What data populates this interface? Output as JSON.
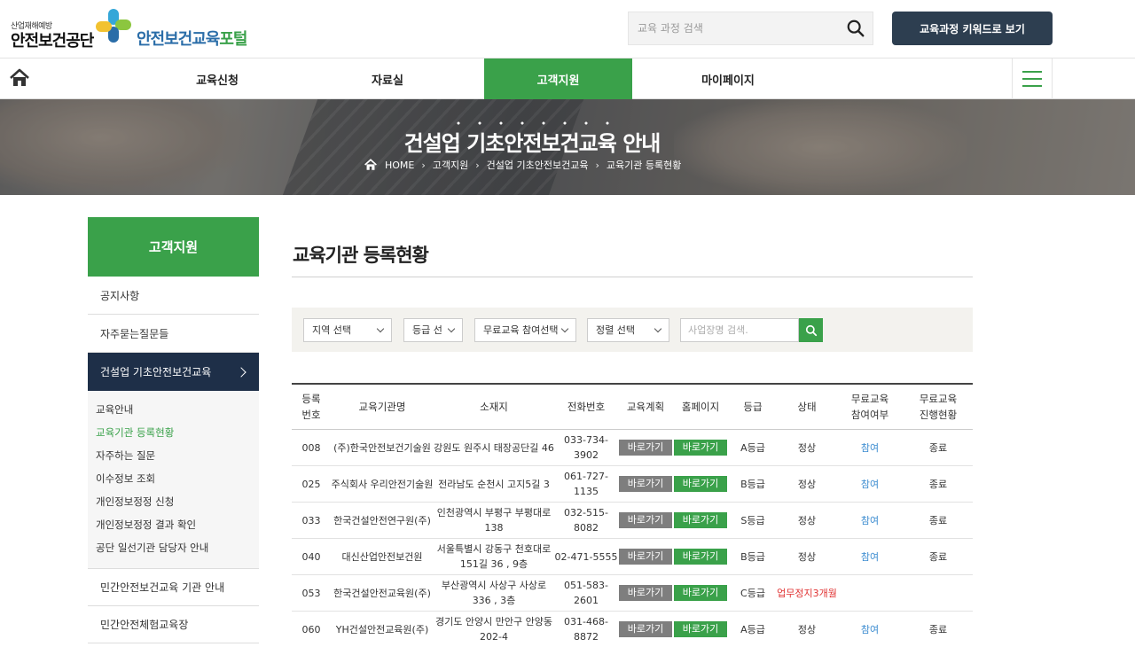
{
  "header": {
    "logo_small": "산업재해예방",
    "logo_org": "안전보건공단",
    "logo_portal_a": "안전보건교육",
    "logo_portal_b": "포털",
    "search_placeholder": "교육 과정 검색",
    "keyword_button": "교육과정 키워드로 보기"
  },
  "nav": {
    "items": [
      "교육신청",
      "자료실",
      "고객지원",
      "마이페이지"
    ],
    "active": "고객지원"
  },
  "banner": {
    "title": "건설업 기초안전보건교육 안내",
    "breadcrumb": [
      "HOME",
      "고객지원",
      "건설업 기초안전보건교육",
      "교육기관 등록현황"
    ]
  },
  "sidebar": {
    "title": "고객지원",
    "links": [
      "공지사항",
      "자주묻는질문들",
      "건설업 기초안전보건교육"
    ],
    "sub": [
      "교육안내",
      "교육기관 등록현황",
      "자주하는 질문",
      "이수정보 조회",
      "개인정보정정 신청",
      "개인정보정정 결과 확인",
      "공단 일선기관 담당자 안내"
    ],
    "bottom": [
      "민간안전보건교육 기관 안내",
      "민간안전체험교육장"
    ]
  },
  "main": {
    "title": "교육기관 등록현황",
    "filters": {
      "region": "지역 선택",
      "grade": "등급 선",
      "free": "무료교육 참여선택",
      "status": "정렬 선택",
      "search_placeholder": "사업장명 검색."
    }
  },
  "table": {
    "headers": [
      "등록\n번호",
      "교육기관명",
      "소재지",
      "전화번호",
      "교육계획",
      "홈페이지",
      "등급",
      "상태",
      "무료교육\n참여여부",
      "무료교육\n진행현황"
    ],
    "button_label": "바로가기",
    "rows": [
      {
        "no": "008",
        "name": "(주)한국안전보건기술원",
        "addr": "강원도 원주시 태장공단길 46",
        "tel": "033-734-3902",
        "grade": "A등급",
        "status": "정상",
        "free": "참여",
        "progress": "종료"
      },
      {
        "no": "025",
        "name": "주식회사 우리안전기술원",
        "addr": "전라남도 순천시 고지5길 3",
        "tel": "061-727-1135",
        "grade": "B등급",
        "status": "정상",
        "free": "참여",
        "progress": "종료"
      },
      {
        "no": "033",
        "name": "한국건설안전연구원(주)",
        "addr": "인천광역시 부평구 부평대로 138",
        "tel": "032-515-8082",
        "grade": "S등급",
        "status": "정상",
        "free": "참여",
        "progress": "종료"
      },
      {
        "no": "040",
        "name": "대신산업안전보건원",
        "addr": "서울특별시 강동구 천호대로151길 36 , 9층",
        "tel": "02-471-5555",
        "grade": "B등급",
        "status": "정상",
        "free": "참여",
        "progress": "종료"
      },
      {
        "no": "053",
        "name": "한국건설안전교육원(주)",
        "addr": "부산광역시 사상구 사상로 336 , 3층",
        "tel": "051-583-2601",
        "grade": "C등급",
        "status": "업무정지3개월",
        "free": "",
        "progress": ""
      },
      {
        "no": "060",
        "name": "YH건설안전교육원(주)",
        "addr": "경기도 안양시 만안구 안양동 202-4",
        "tel": "031-468-8872",
        "grade": "A등급",
        "status": "정상",
        "free": "참여",
        "progress": "종료"
      }
    ]
  },
  "colors": {
    "green": "#3aa14a",
    "navy": "#1e2f48",
    "button_dark": "#2d3e50",
    "gray_button": "#7e7e7e",
    "link_blue": "#3a8bd0",
    "alert_red": "#e03131"
  }
}
